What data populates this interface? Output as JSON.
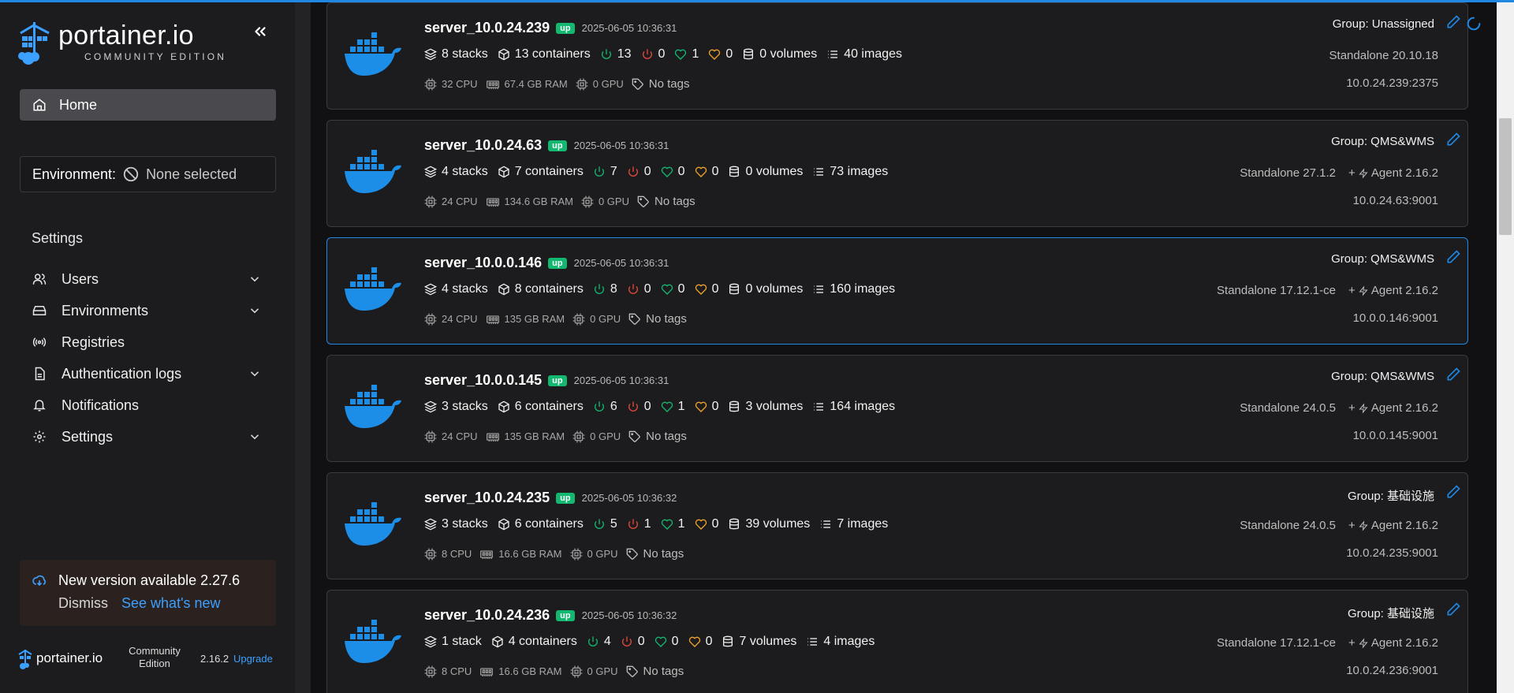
{
  "brand": {
    "name": "portainer.io",
    "edition": "COMMUNITY EDITION"
  },
  "nav": {
    "home_label": "Home",
    "environment_label": "Environment:",
    "environment_value": "None selected",
    "settings_title": "Settings",
    "items": [
      {
        "label": "Users",
        "icon": "users-icon",
        "expandable": true
      },
      {
        "label": "Environments",
        "icon": "hard-drive-icon",
        "expandable": true
      },
      {
        "label": "Registries",
        "icon": "radio-icon",
        "expandable": false
      },
      {
        "label": "Authentication logs",
        "icon": "file-text-icon",
        "expandable": true
      },
      {
        "label": "Notifications",
        "icon": "bell-icon",
        "expandable": false
      },
      {
        "label": "Settings",
        "icon": "gear-icon",
        "expandable": true
      }
    ]
  },
  "update": {
    "message": "New version available 2.27.6",
    "dismiss": "Dismiss",
    "link": "See what's new"
  },
  "footer": {
    "name": "portainer.io",
    "edition": "Community Edition",
    "version": "2.16.2",
    "upgrade": "Upgrade"
  },
  "colors": {
    "accent": "#1e88e5",
    "up_badge": "#12b870",
    "running": "#12b870",
    "stopped": "#e5483a",
    "healthy": "#12b870",
    "unhealthy": "#f0a32a"
  },
  "environments": [
    {
      "name": "server_10.0.24.239",
      "status": "up",
      "timestamp": "2025-06-05 10:36:31",
      "stacks": "8 stacks",
      "containers": "13 containers",
      "running": "13",
      "stopped": "0",
      "healthy": "1",
      "unhealthy": "0",
      "volumes": "0 volumes",
      "images": "40 images",
      "cpu": "32 CPU",
      "ram": "67.4 GB RAM",
      "gpu": "0 GPU",
      "tags": "No tags",
      "group": "Group: Unassigned",
      "platform": "Standalone 20.10.18",
      "agent": "",
      "address": "10.0.24.239:2375",
      "selected": false
    },
    {
      "name": "server_10.0.24.63",
      "status": "up",
      "timestamp": "2025-06-05 10:36:31",
      "stacks": "4 stacks",
      "containers": "7 containers",
      "running": "7",
      "stopped": "0",
      "healthy": "0",
      "unhealthy": "0",
      "volumes": "0 volumes",
      "images": "73 images",
      "cpu": "24 CPU",
      "ram": "134.6 GB RAM",
      "gpu": "0 GPU",
      "tags": "No tags",
      "group": "Group: QMS&WMS",
      "platform": "Standalone 27.1.2",
      "agent": "Agent 2.16.2",
      "address": "10.0.24.63:9001",
      "selected": false
    },
    {
      "name": "server_10.0.0.146",
      "status": "up",
      "timestamp": "2025-06-05 10:36:31",
      "stacks": "4 stacks",
      "containers": "8 containers",
      "running": "8",
      "stopped": "0",
      "healthy": "0",
      "unhealthy": "0",
      "volumes": "0 volumes",
      "images": "160 images",
      "cpu": "24 CPU",
      "ram": "135 GB RAM",
      "gpu": "0 GPU",
      "tags": "No tags",
      "group": "Group: QMS&WMS",
      "platform": "Standalone 17.12.1-ce",
      "agent": "Agent 2.16.2",
      "address": "10.0.0.146:9001",
      "selected": true
    },
    {
      "name": "server_10.0.0.145",
      "status": "up",
      "timestamp": "2025-06-05 10:36:31",
      "stacks": "3 stacks",
      "containers": "6 containers",
      "running": "6",
      "stopped": "0",
      "healthy": "1",
      "unhealthy": "0",
      "volumes": "3 volumes",
      "images": "164 images",
      "cpu": "24 CPU",
      "ram": "135 GB RAM",
      "gpu": "0 GPU",
      "tags": "No tags",
      "group": "Group: QMS&WMS",
      "platform": "Standalone 24.0.5",
      "agent": "Agent 2.16.2",
      "address": "10.0.0.145:9001",
      "selected": false
    },
    {
      "name": "server_10.0.24.235",
      "status": "up",
      "timestamp": "2025-06-05 10:36:32",
      "stacks": "3 stacks",
      "containers": "6 containers",
      "running": "5",
      "stopped": "1",
      "healthy": "1",
      "unhealthy": "0",
      "volumes": "39 volumes",
      "images": "7 images",
      "cpu": "8 CPU",
      "ram": "16.6 GB RAM",
      "gpu": "0 GPU",
      "tags": "No tags",
      "group": "Group: 基础设施",
      "platform": "Standalone 24.0.5",
      "agent": "Agent 2.16.2",
      "address": "10.0.24.235:9001",
      "selected": false
    },
    {
      "name": "server_10.0.24.236",
      "status": "up",
      "timestamp": "2025-06-05 10:36:32",
      "stacks": "1 stack",
      "containers": "4 containers",
      "running": "4",
      "stopped": "0",
      "healthy": "0",
      "unhealthy": "0",
      "volumes": "7 volumes",
      "images": "4 images",
      "cpu": "8 CPU",
      "ram": "16.6 GB RAM",
      "gpu": "0 GPU",
      "tags": "No tags",
      "group": "Group: 基础设施",
      "platform": "Standalone 17.12.1-ce",
      "agent": "Agent 2.16.2",
      "address": "10.0.24.236:9001",
      "selected": false
    }
  ]
}
